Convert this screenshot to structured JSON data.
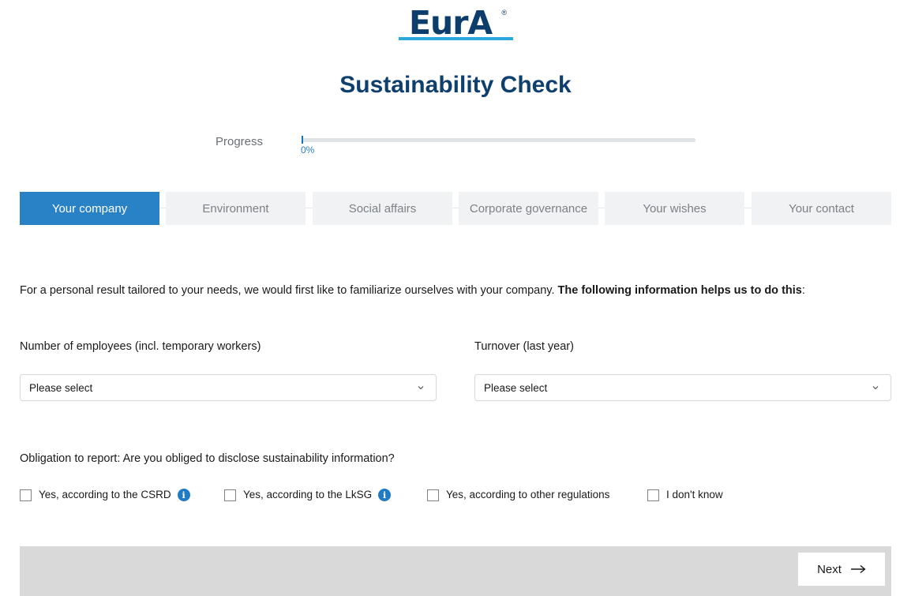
{
  "logo": {
    "text": "EurA",
    "registered": "®"
  },
  "title": "Sustainability Check",
  "progress": {
    "label": "Progress",
    "value_text": "0%",
    "value": 0
  },
  "tabs": [
    {
      "label": "Your company",
      "active": true
    },
    {
      "label": "Environment",
      "active": false
    },
    {
      "label": "Social affairs",
      "active": false
    },
    {
      "label": "Corporate governance",
      "active": false
    },
    {
      "label": "Your wishes",
      "active": false
    },
    {
      "label": "Your contact",
      "active": false
    }
  ],
  "intro": {
    "text": "For a personal result tailored to your needs, we would first like to familiarize ourselves with your company. ",
    "bold": "The following information helps us to do this",
    "suffix": ":"
  },
  "fields": {
    "employees": {
      "label": "Number of employees (incl. temporary workers)",
      "value": "Please select"
    },
    "turnover": {
      "label": "Turnover (last year)",
      "value": "Please select"
    }
  },
  "reporting": {
    "question": "Obligation to report: Are you obliged to disclose sustainability information?",
    "options": [
      {
        "label": "Yes, according to the CSRD",
        "info": true,
        "checked": false
      },
      {
        "label": "Yes, according to the LkSG",
        "info": true,
        "checked": false
      },
      {
        "label": "Yes, according to other regulations",
        "info": false,
        "checked": false
      },
      {
        "label": "I don't know",
        "info": false,
        "checked": false
      }
    ],
    "info_glyph": "i"
  },
  "footer": {
    "next_label": "Next",
    "next_icon": "arrow-right-icon"
  },
  "colors": {
    "brand_blue": "#0e3f6d",
    "accent_blue": "#2a82c6",
    "logo_bar": "#2aa7df"
  }
}
